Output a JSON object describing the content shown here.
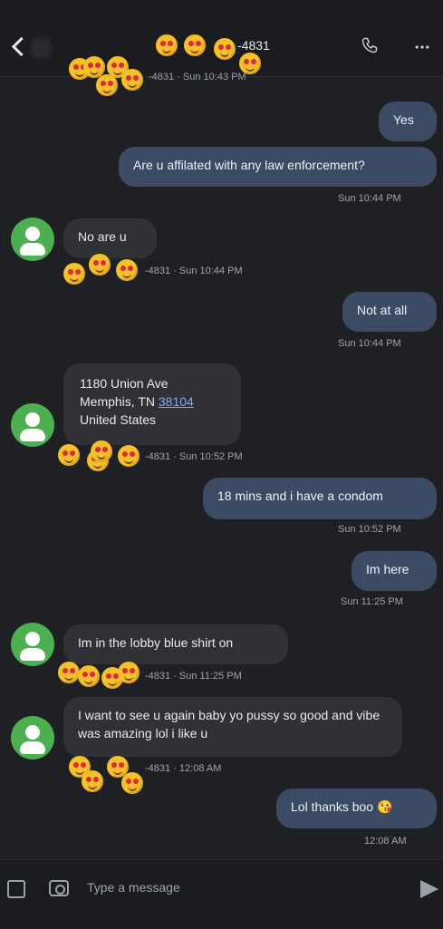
{
  "header": {
    "title": "-4831",
    "subtitle": "-4831 · Sun 10:43 PM",
    "icons": [
      "back-icon",
      "phone-icon",
      "more-icon"
    ]
  },
  "messages": [
    {
      "dir": "out",
      "text": "Yes"
    },
    {
      "dir": "out",
      "text": "Are u affilated with any law enforcement?",
      "time": "Sun 10:44 PM"
    },
    {
      "dir": "in",
      "text": "No are u",
      "meta": "-4831 · Sun 10:44 PM"
    },
    {
      "dir": "out",
      "text": "Not at all",
      "time": "Sun 10:44 PM"
    },
    {
      "dir": "in",
      "address_line1": "1180 Union Ave",
      "address_line2_prefix": "Memphis, TN",
      "address_zip": "38104",
      "address_line3": "United States",
      "meta": "-4831 · Sun 10:52 PM"
    },
    {
      "dir": "out",
      "text": "18 mins and i have a condom",
      "time": "Sun 10:52 PM"
    },
    {
      "dir": "out",
      "text": "Im here",
      "time": "Sun 11:25 PM"
    },
    {
      "dir": "in",
      "text": "Im in the lobby blue shirt on",
      "meta": "-4831 · Sun 11:25 PM"
    },
    {
      "dir": "in",
      "text": "I want to see u again baby yo pussy so good and vibe was amazing lol i like u",
      "meta": "-4831 · 12:08 AM"
    },
    {
      "dir": "out",
      "text": "Lol thanks boo 😘",
      "time": "12:08 AM"
    }
  ],
  "composer": {
    "placeholder": "Type a message",
    "icons": [
      "gallery-icon",
      "camera-icon",
      "send-icon"
    ]
  },
  "colors": {
    "background": "#1f2023",
    "outgoing_bubble": "#3a4b63",
    "incoming_bubble": "#2f3134",
    "avatar": "#4caf50",
    "link": "#7aa7ff"
  }
}
